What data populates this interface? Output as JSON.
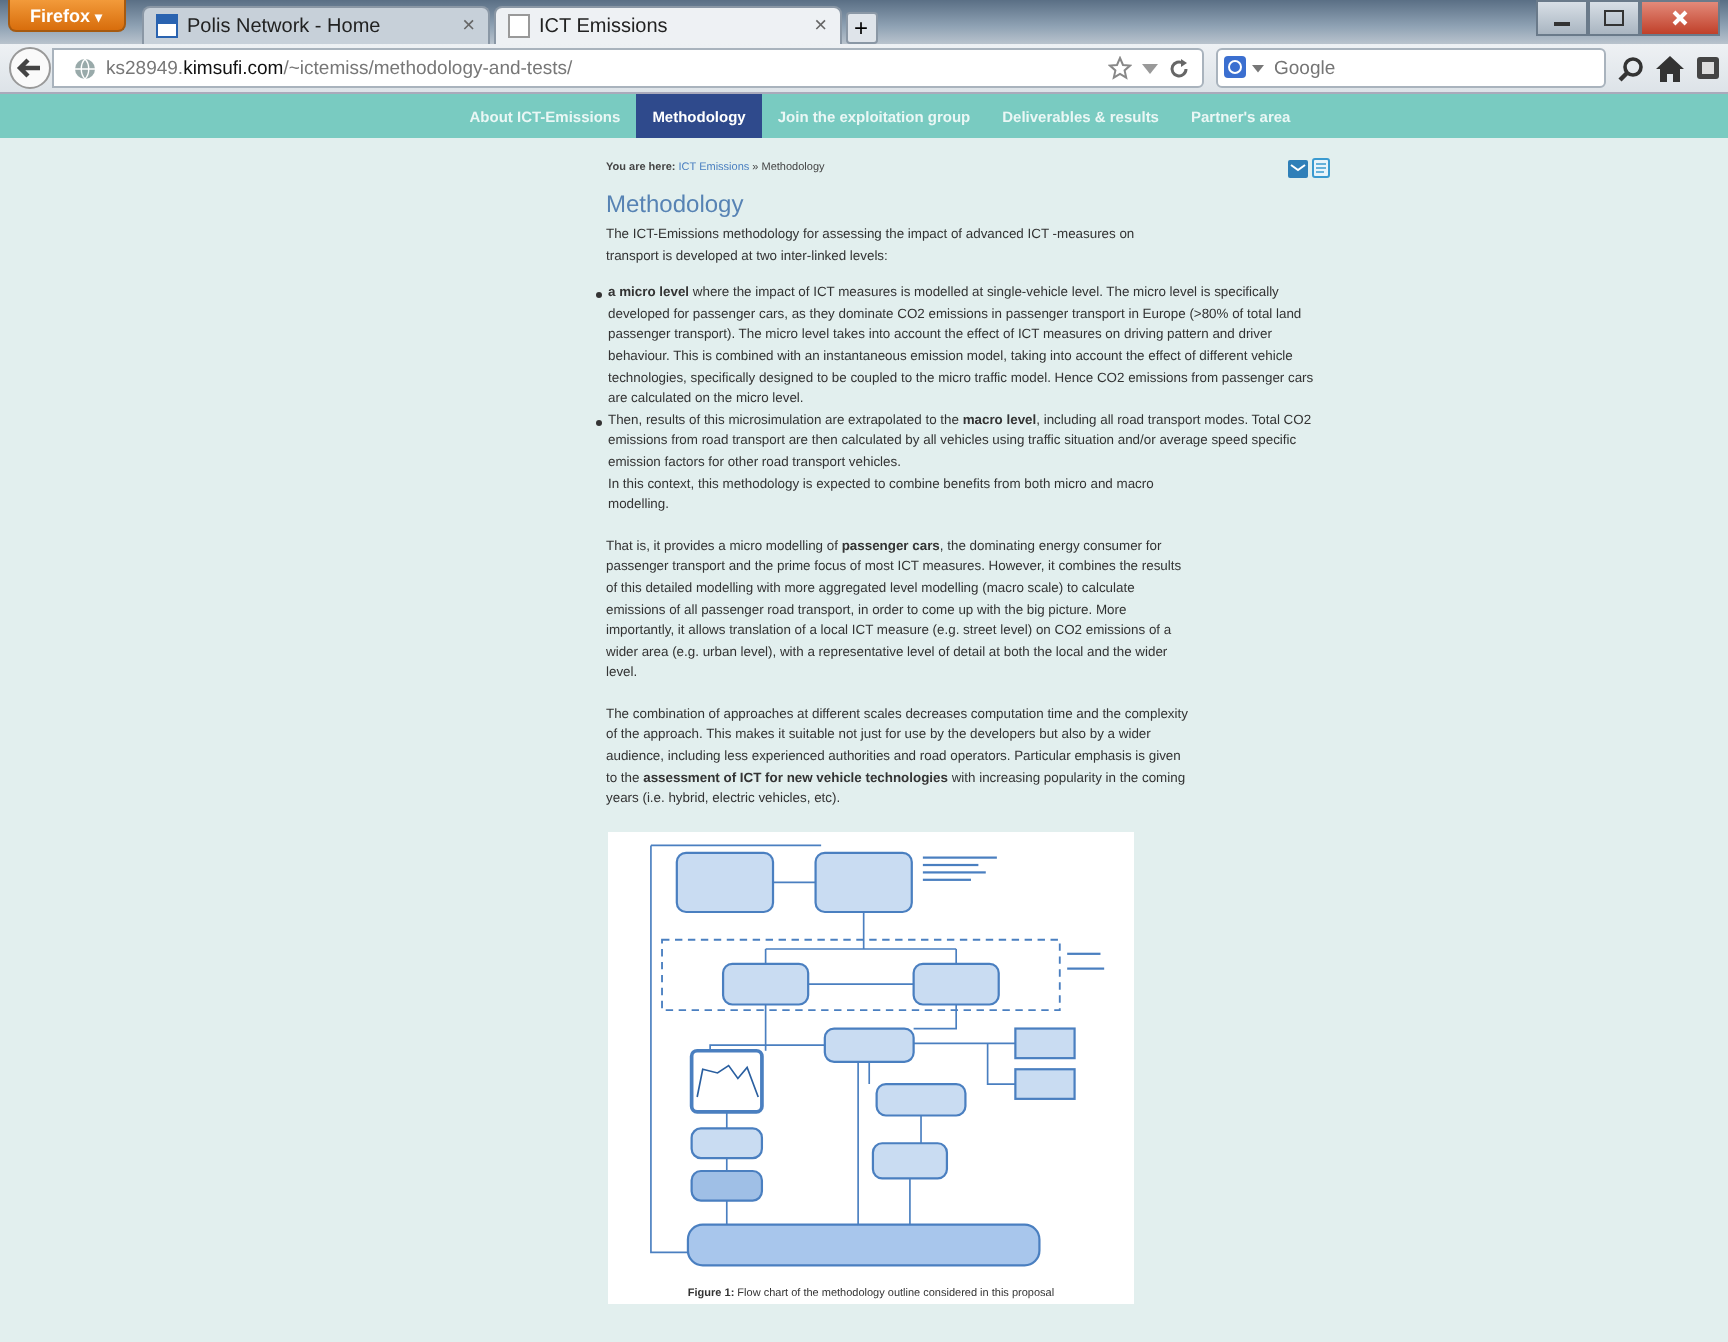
{
  "browser": {
    "menu_button": "Firefox",
    "menu_caret": "▾",
    "tabs": [
      {
        "title": "Polis Network - Home",
        "selected": false,
        "close": "×"
      },
      {
        "title": "ICT Emissions",
        "selected": true,
        "close": "×"
      }
    ],
    "new_tab": "+",
    "url": "ks28949.**kimsufi.com**/~ictemiss/methodology-and-tests/",
    "search": {
      "placeholder": "Google"
    }
  },
  "nav": [
    {
      "label": "About ICT-Emissions",
      "selected": false
    },
    {
      "label": "Methodology",
      "selected": true
    },
    {
      "label": "Join the exploitation group",
      "selected": false
    },
    {
      "label": "Deliverables & results",
      "selected": false
    },
    {
      "label": "Partner's area",
      "selected": false
    }
  ],
  "breadcrumb": {
    "label": "You are here:",
    "link": "ICT Emissions",
    "separator": "»",
    "current": "Methodology"
  },
  "title": "Methodology",
  "intro": "The ICT-Emissions methodology for assessing the impact of advanced ICT -measures on transport is developed at two inter-linked levels:",
  "bullets": [
    {
      "text": "**a micro level** where the impact of ICT measures is modelled at single-vehicle level. The micro level is specifically developed for passenger cars, as they dominate CO2  emissions in passenger transport in Europe (>80% of total land passenger transport). The micro level takes into account the effect of ICT measures on driving pattern and driver behaviour. This is combined with an instantaneous emission model, taking into account the effect of different vehicle technologies, specifically designed to be coupled to the micro traffic model. Hence CO2 emissions from passenger cars are calculated on the micro level."
    },
    {
      "text": "Then, results of this microsimulation are extrapolated to the **macro level**, including all road transport modes. Total CO2 emissions from road transport are then calculated by all vehicles using traffic situation and/or average speed specific emission factors for other road transport vehicles.",
      "note": "In this context, this methodology is expected to combine benefits from both micro and macro modelling."
    }
  ],
  "paragraphs": [
    "That is, it provides a micro modelling of **passenger cars**, the dominating energy consumer for passenger transport and the prime focus of most ICT measures. However, it combines the results of this detailed modelling with more aggregated level modelling (macro scale) to calculate emissions of all passenger road transport, in order to come up with the big picture. More importantly, it allows translation of a local ICT measure (e.g. street level) on CO2  emissions of a wider area (e.g. urban level), with a representative level of detail at both the local and the wider level.",
    "The combination of approaches at different scales decreases computation time and the complexity of the approach. This makes it suitable not just for use by the developers but also by a wider audience, including less experienced authorities and road operators. Particular emphasis is given to the **assessment of ICT for new vehicle technologies** with increasing popularity in the coming years (i.e. hybrid, electric vehicles, etc)."
  ],
  "figure": {
    "caption": "**Figure 1:** Flow chart of the methodology outline considered in this proposal"
  }
}
